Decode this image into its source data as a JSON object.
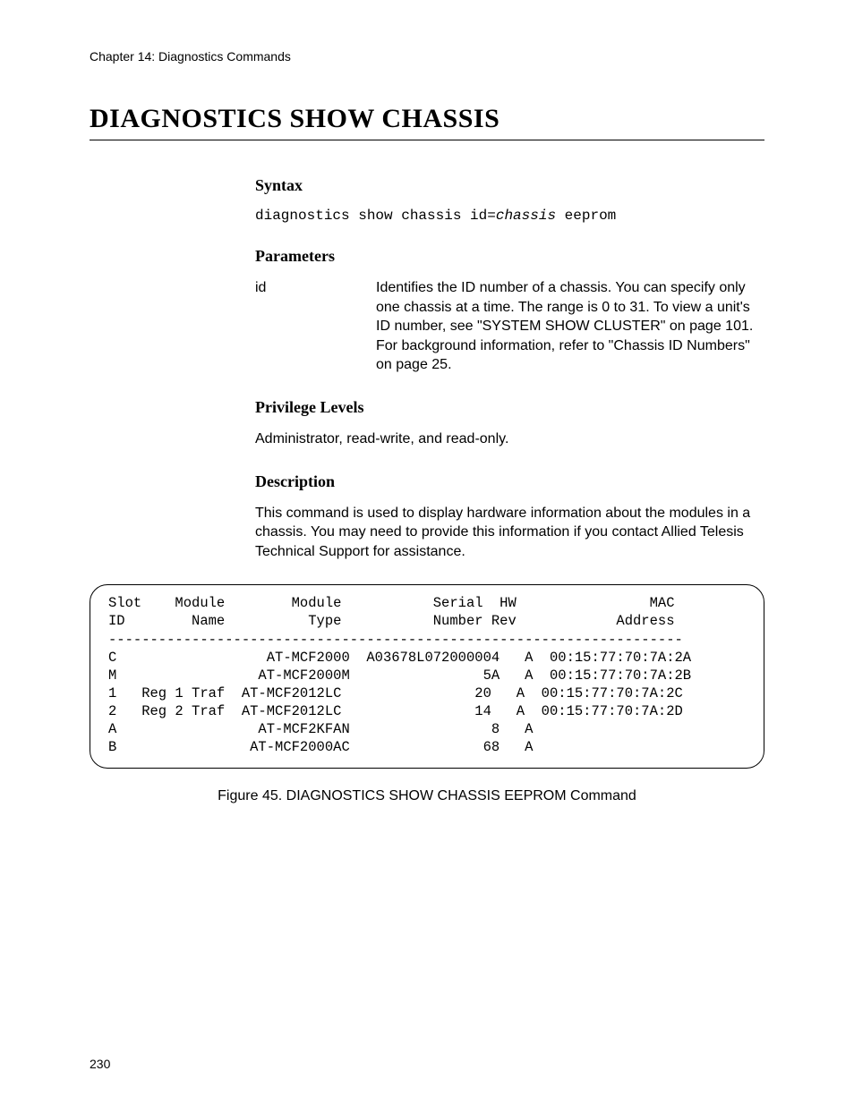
{
  "header": {
    "chapter": "Chapter 14: Diagnostics Commands"
  },
  "title": "DIAGNOSTICS SHOW CHASSIS",
  "sections": {
    "syntax": {
      "heading": "Syntax",
      "cmd_prefix": "diagnostics show chassis id=",
      "cmd_var": "chassis",
      "cmd_suffix": " eeprom"
    },
    "parameters": {
      "heading": "Parameters",
      "items": [
        {
          "name": "id",
          "desc": "Identifies the ID number of a chassis. You can specify only one chassis at a time. The range is 0 to 31. To view a unit's ID number, see \"SYSTEM SHOW CLUSTER\" on page 101. For background information, refer to \"Chassis ID Numbers\" on page 25."
        }
      ]
    },
    "privilege": {
      "heading": "Privilege Levels",
      "text": "Administrator, read-write, and read-only."
    },
    "description": {
      "heading": "Description",
      "text": "This command is used to display hardware information about the modules in a chassis. You may need to provide this information if you contact Allied Telesis Technical Support for assistance."
    }
  },
  "output": {
    "text": "Slot    Module        Module           Serial  HW                MAC\nID        Name          Type           Number Rev            Address\n---------------------------------------------------------------------\nC                  AT-MCF2000  A03678L072000004   A  00:15:77:70:7A:2A\nM                 AT-MCF2000M                5A   A  00:15:77:70:7A:2B\n1   Reg 1 Traf  AT-MCF2012LC                20   A  00:15:77:70:7A:2C\n2   Reg 2 Traf  AT-MCF2012LC                14   A  00:15:77:70:7A:2D\nA                 AT-MCF2KFAN                 8   A\nB                AT-MCF2000AC                68   A"
  },
  "figure_caption": "Figure 45. DIAGNOSTICS SHOW CHASSIS EEPROM Command",
  "page_number": "230"
}
